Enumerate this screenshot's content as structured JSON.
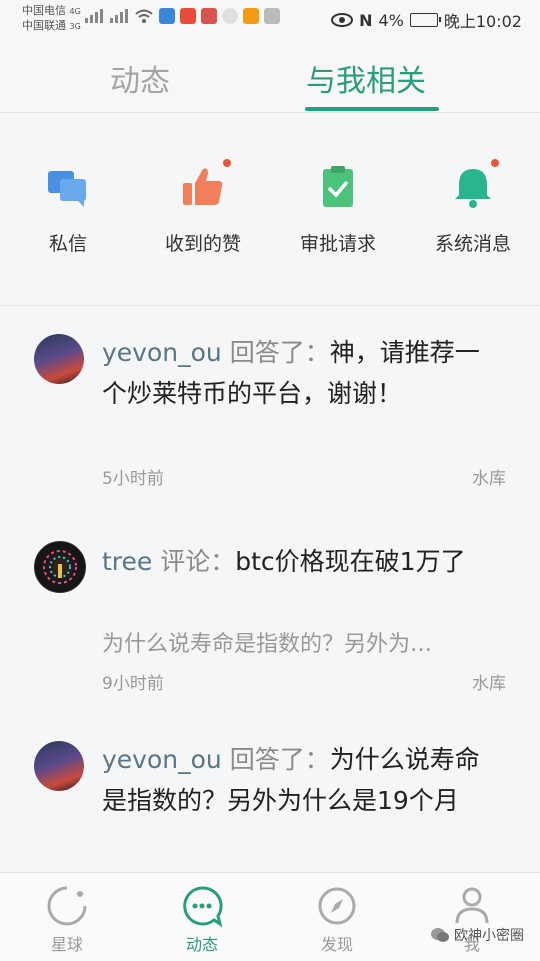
{
  "status": {
    "carrier1": "中国电信",
    "carrier1_net": "4G",
    "carrier2": "中国联通",
    "carrier2_net": "3G",
    "battery": "4%",
    "time": "晚上10:02"
  },
  "tabs": [
    {
      "label": "动态",
      "active": false
    },
    {
      "label": "与我相关",
      "active": true
    }
  ],
  "quick_actions": [
    {
      "label": "私信",
      "icon": "chat-bubbles-icon",
      "badge": false
    },
    {
      "label": "收到的赞",
      "icon": "thumbs-up-icon",
      "badge": true
    },
    {
      "label": "审批请求",
      "icon": "clipboard-check-icon",
      "badge": false
    },
    {
      "label": "系统消息",
      "icon": "bell-icon",
      "badge": true
    }
  ],
  "feed": [
    {
      "user": "yevon_ou",
      "action": "回答了：",
      "content": "神，请推荐一个炒莱特币的平台，谢谢！",
      "quote": "",
      "time": "5小时前",
      "source": "水库"
    },
    {
      "user": "tree",
      "action": "评论：",
      "content": "btc价格现在破1万了",
      "quote": "为什么说寿命是指数的？另外为…",
      "time": "9小时前",
      "source": "水库"
    },
    {
      "user": "yevon_ou",
      "action": "回答了：",
      "content": "为什么说寿命是指数的？另外为什么是19个月",
      "quote": "",
      "time": "",
      "source": ""
    }
  ],
  "bottom_nav": [
    {
      "label": "星球",
      "icon": "planet-icon",
      "active": false
    },
    {
      "label": "动态",
      "icon": "chat-dots-icon",
      "active": true
    },
    {
      "label": "发现",
      "icon": "compass-icon",
      "active": false
    },
    {
      "label": "我",
      "icon": "person-icon",
      "active": false
    }
  ],
  "watermark": "欧神小密圈",
  "colors": {
    "accent": "#2a9d7d",
    "badge": "#e8543a",
    "chat": "#4a90e2",
    "like": "#f07f5a",
    "approve": "#4cc37a",
    "bell": "#2bb58f"
  }
}
